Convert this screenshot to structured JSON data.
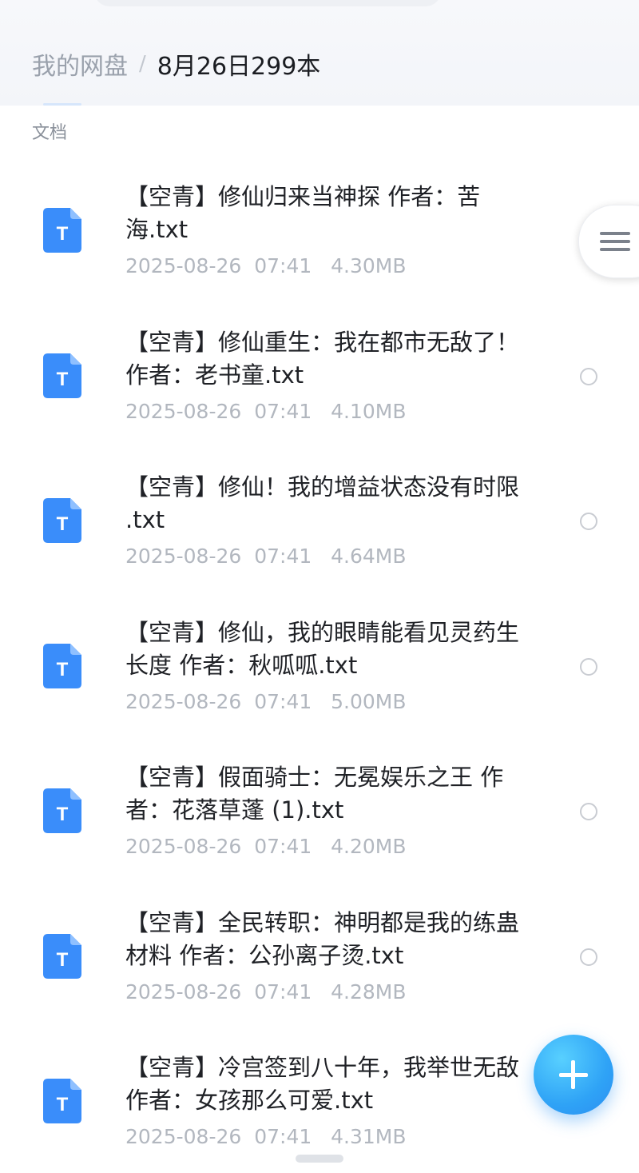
{
  "breadcrumb": {
    "root": "我的网盘",
    "separator": "/",
    "current": "8月26日299本"
  },
  "section_label": "文档",
  "file_icon_letter": "T",
  "accent_color": "#3a8dfa",
  "files": [
    {
      "name": "【空青】修仙归来当神探 作者：苦海.txt",
      "date": "2025-08-26",
      "time": "07:41",
      "size": "4.30MB"
    },
    {
      "name": "【空青】修仙重生：我在都市无敌了！ 作者：老书童.txt",
      "date": "2025-08-26",
      "time": "07:41",
      "size": "4.10MB"
    },
    {
      "name": "【空青】修仙！我的增益状态没有时限 .txt",
      "date": "2025-08-26",
      "time": "07:41",
      "size": "4.64MB"
    },
    {
      "name": "【空青】修仙，我的眼睛能看见灵药生长度 作者：秋呱呱.txt",
      "date": "2025-08-26",
      "time": "07:41",
      "size": "5.00MB"
    },
    {
      "name": "【空青】假面骑士：无冕娱乐之王 作者：花落草蓬 (1).txt",
      "date": "2025-08-26",
      "time": "07:41",
      "size": "4.20MB"
    },
    {
      "name": "【空青】全民转职：神明都是我的练蛊材料 作者：公孙离子烫.txt",
      "date": "2025-08-26",
      "time": "07:41",
      "size": "4.28MB"
    },
    {
      "name": "【空青】冷宫签到八十年，我举世无敌 作者：女孩那么可爱.txt",
      "date": "2025-08-26",
      "time": "07:41",
      "size": "4.31MB"
    }
  ]
}
